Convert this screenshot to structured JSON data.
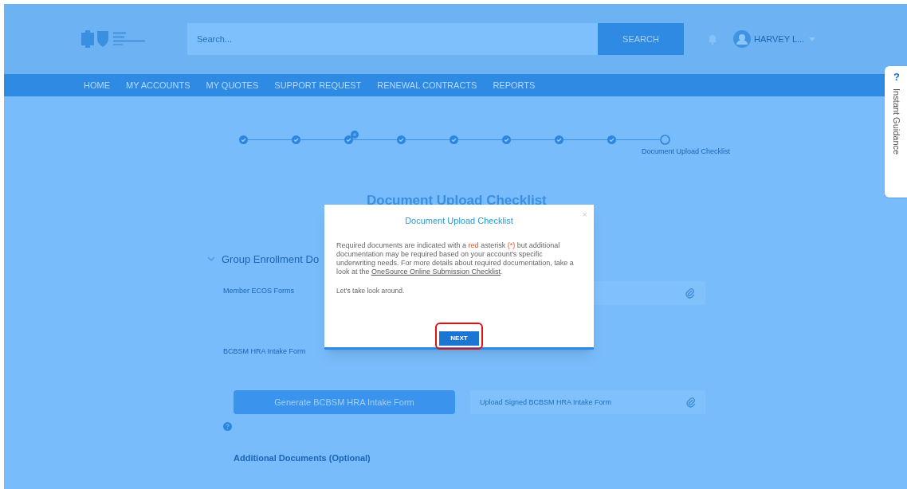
{
  "header": {
    "search": {
      "placeholder": "Search..."
    },
    "search_button": "SEARCH",
    "user_name": "HARVEY L..."
  },
  "nav": [
    {
      "label": "HOME"
    },
    {
      "label": "MY ACCOUNTS"
    },
    {
      "label": "MY QUOTES"
    },
    {
      "label": "SUPPORT REQUEST"
    },
    {
      "label": "RENEWAL CONTRACTS"
    },
    {
      "label": "REPORTS"
    }
  ],
  "stepper": [
    {
      "complete": true
    },
    {
      "complete": true
    },
    {
      "complete": true,
      "badge": true
    },
    {
      "complete": true
    },
    {
      "complete": true
    },
    {
      "complete": true
    },
    {
      "complete": true
    },
    {
      "complete": true
    },
    {
      "complete": false,
      "label": "Document Upload Checklist"
    }
  ],
  "page_title": "Document Upload Checklist",
  "section": {
    "title": "Group Enrollment Do",
    "expanded": true
  },
  "forms": [
    {
      "label": "Member ECOS Forms"
    },
    {
      "label": "BCBSM HRA Intake Form"
    }
  ],
  "generate_button": "Generate BCBSM HRA Intake Form",
  "upload_field": {
    "placeholder": "Upload Signed BCBSM HRA Intake Form"
  },
  "additional": "Additional Documents (Optional)",
  "guidance_tab": {
    "icon": "?",
    "label": "Instant Guidance"
  },
  "modal": {
    "title": "Document Upload Checklist",
    "close": "×",
    "body": [
      {
        "kind": "text",
        "text": "Required documents are indicated with a "
      },
      {
        "kind": "red",
        "text": "red"
      },
      {
        "kind": "text",
        "text": " asterisk "
      },
      {
        "kind": "red",
        "text": "(*)"
      },
      {
        "kind": "text",
        "text": " but additional documentation may be required based on your account's specific underwriting needs. For more details about required documentation, take a look at the "
      },
      {
        "kind": "link",
        "text": "OneSource Online Submission Checklist"
      },
      {
        "kind": "text",
        "text": "."
      }
    ],
    "note": "Let's take look around.",
    "button": {
      "label": "NEXT",
      "highlighted": true
    }
  }
}
